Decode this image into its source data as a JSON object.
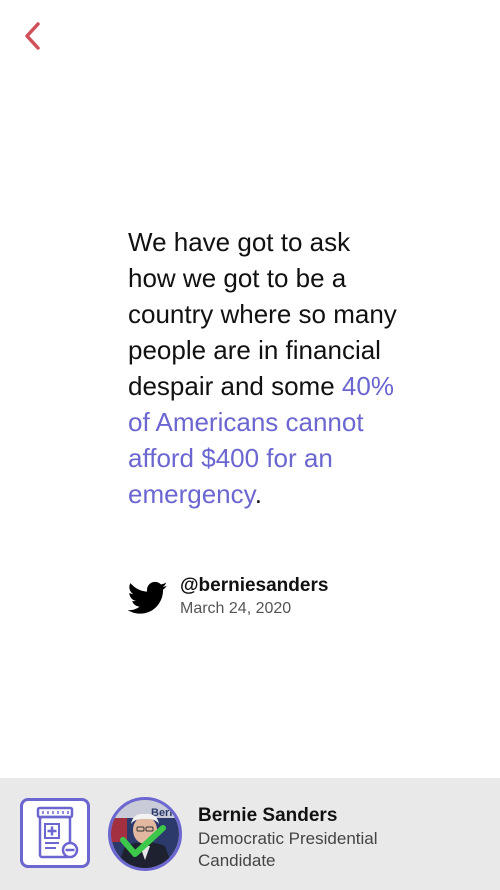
{
  "nav": {
    "back_icon": "chevron-left-icon"
  },
  "quote": {
    "plain_text": "We have got to ask how we got to be a country where so many people are in financial despair and some ",
    "highlight_text": "40% of Americans cannot afford $400 for an emergency",
    "end_punct": "."
  },
  "attribution": {
    "icon": "twitter-bird-icon",
    "handle": "@berniesanders",
    "date": "March 24, 2020"
  },
  "footer": {
    "policy_icon": "prescription-bottle-icon",
    "avatar_icon": "candidate-photo",
    "check_icon": "checkmark-icon",
    "name": "Bernie Sanders",
    "title": "Democratic Presidential Candidate"
  },
  "colors": {
    "accent": "#6b66d0",
    "back": "#d0505a",
    "footer_bg": "#e9e9e9",
    "twitter": "#000000",
    "check": "#3cc84a"
  }
}
